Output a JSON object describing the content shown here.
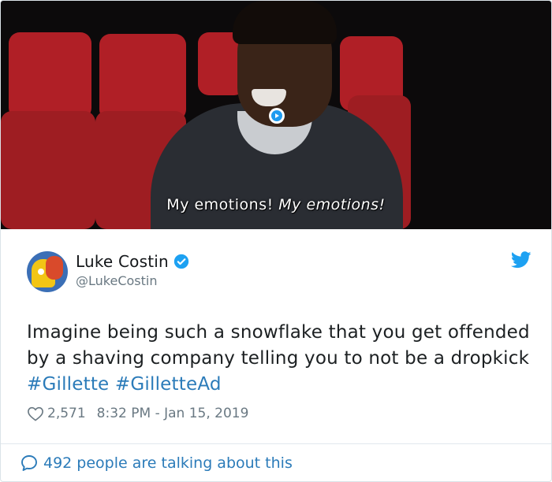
{
  "media": {
    "caption_part1": "My emotions!",
    "caption_part2": "My emotions!"
  },
  "author": {
    "name": "Luke Costin",
    "handle": "@LukeCostin",
    "verified": true
  },
  "tweet": {
    "text": "Imagine being such a snowflake that you get offended by a shaving company telling you to not be a dropkick ",
    "hashtags": [
      "#Gillette",
      "#GilletteAd"
    ]
  },
  "meta": {
    "likes": "2,571",
    "timestamp": "8:32 PM - Jan 15, 2019"
  },
  "footer": {
    "talking": "492 people are talking about this"
  },
  "colors": {
    "link": "#2b7bb9",
    "text": "#1c2022",
    "muted": "#697882",
    "twitter_blue": "#1da1f2"
  },
  "icons": [
    "play-icon",
    "verified-icon",
    "twitter-bird-icon",
    "heart-icon",
    "comment-bubble-icon"
  ]
}
